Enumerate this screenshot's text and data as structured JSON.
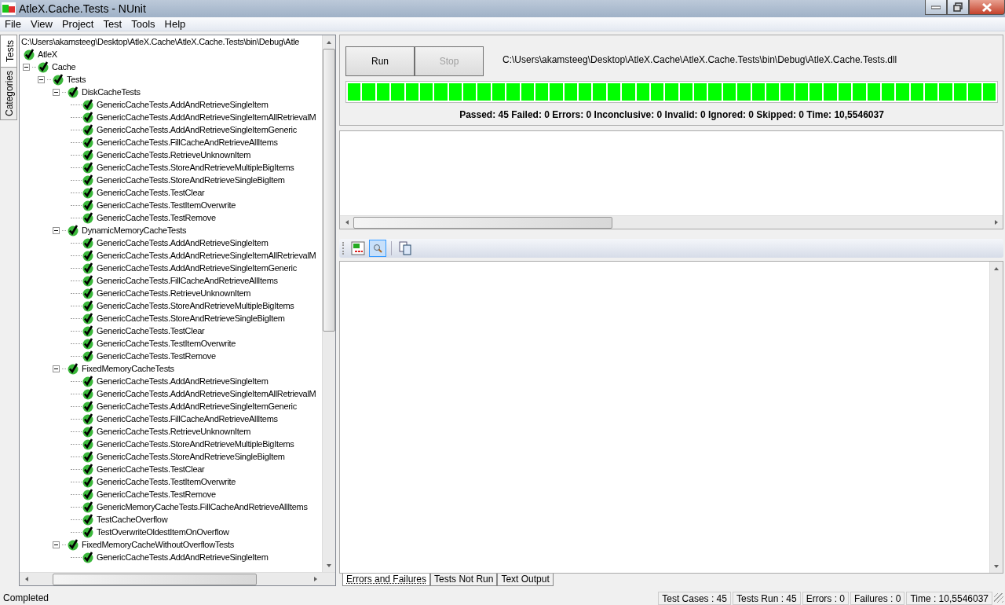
{
  "window": {
    "title": "AtleX.Cache.Tests - NUnit"
  },
  "menu": [
    {
      "label": "File"
    },
    {
      "label": "View"
    },
    {
      "label": "Project"
    },
    {
      "label": "Test"
    },
    {
      "label": "Tools"
    },
    {
      "label": "Help"
    }
  ],
  "side_tabs": [
    {
      "label": "Tests",
      "selected": true
    },
    {
      "label": "Categories",
      "selected": false
    }
  ],
  "tree": {
    "path": "C:\\Users\\akamsteeg\\Desktop\\AtleX.Cache\\AtleX.Cache.Tests\\bin\\Debug\\Atle",
    "nodes": [
      {
        "label": "AtleX",
        "children": [
          {
            "label": "Cache",
            "expanded": true,
            "children": [
              {
                "label": "Tests",
                "expanded": true,
                "children": [
                  {
                    "label": "DiskCacheTests",
                    "expanded": true,
                    "children": [
                      {
                        "label": "GenericCacheTests.AddAndRetrieveSingleItem"
                      },
                      {
                        "label": "GenericCacheTests.AddAndRetrieveSingleItemAllRetrievalM"
                      },
                      {
                        "label": "GenericCacheTests.AddAndRetrieveSingleItemGeneric"
                      },
                      {
                        "label": "GenericCacheTests.FillCacheAndRetrieveAllItems"
                      },
                      {
                        "label": "GenericCacheTests.RetrieveUnknownItem"
                      },
                      {
                        "label": "GenericCacheTests.StoreAndRetrieveMultipleBigItems"
                      },
                      {
                        "label": "GenericCacheTests.StoreAndRetrieveSingleBigItem"
                      },
                      {
                        "label": "GenericCacheTests.TestClear"
                      },
                      {
                        "label": "GenericCacheTests.TestItemOverwrite"
                      },
                      {
                        "label": "GenericCacheTests.TestRemove"
                      }
                    ]
                  },
                  {
                    "label": "DynamicMemoryCacheTests",
                    "expanded": true,
                    "children": [
                      {
                        "label": "GenericCacheTests.AddAndRetrieveSingleItem"
                      },
                      {
                        "label": "GenericCacheTests.AddAndRetrieveSingleItemAllRetrievalM"
                      },
                      {
                        "label": "GenericCacheTests.AddAndRetrieveSingleItemGeneric"
                      },
                      {
                        "label": "GenericCacheTests.FillCacheAndRetrieveAllItems"
                      },
                      {
                        "label": "GenericCacheTests.RetrieveUnknownItem"
                      },
                      {
                        "label": "GenericCacheTests.StoreAndRetrieveMultipleBigItems"
                      },
                      {
                        "label": "GenericCacheTests.StoreAndRetrieveSingleBigItem"
                      },
                      {
                        "label": "GenericCacheTests.TestClear"
                      },
                      {
                        "label": "GenericCacheTests.TestItemOverwrite"
                      },
                      {
                        "label": "GenericCacheTests.TestRemove"
                      }
                    ]
                  },
                  {
                    "label": "FixedMemoryCacheTests",
                    "expanded": true,
                    "children": [
                      {
                        "label": "GenericCacheTests.AddAndRetrieveSingleItem"
                      },
                      {
                        "label": "GenericCacheTests.AddAndRetrieveSingleItemAllRetrievalM"
                      },
                      {
                        "label": "GenericCacheTests.AddAndRetrieveSingleItemGeneric"
                      },
                      {
                        "label": "GenericCacheTests.FillCacheAndRetrieveAllItems"
                      },
                      {
                        "label": "GenericCacheTests.RetrieveUnknownItem"
                      },
                      {
                        "label": "GenericCacheTests.StoreAndRetrieveMultipleBigItems"
                      },
                      {
                        "label": "GenericCacheTests.StoreAndRetrieveSingleBigItem"
                      },
                      {
                        "label": "GenericCacheTests.TestClear"
                      },
                      {
                        "label": "GenericCacheTests.TestItemOverwrite"
                      },
                      {
                        "label": "GenericCacheTests.TestRemove"
                      },
                      {
                        "label": "GenericMemoryCacheTests.FillCacheAndRetrieveAllItems"
                      },
                      {
                        "label": "TestCacheOverflow"
                      },
                      {
                        "label": "TestOverwriteOldestItemOnOverflow"
                      }
                    ]
                  },
                  {
                    "label": "FixedMemoryCacheWithoutOverflowTests",
                    "expanded": true,
                    "children": [
                      {
                        "label": "GenericCacheTests.AddAndRetrieveSingleItem"
                      }
                    ]
                  }
                ]
              }
            ]
          }
        ]
      }
    ]
  },
  "run_panel": {
    "buttons": [
      {
        "label": "Run",
        "disabled": false
      },
      {
        "label": "Stop",
        "disabled": true
      }
    ],
    "assembly": "C:\\Users\\akamsteeg\\Desktop\\AtleX.Cache\\AtleX.Cache.Tests\\bin\\Debug\\AtleX.Cache.Tests.dll",
    "progress": {
      "level": 1
    },
    "summary": "Passed: 45  Failed: 0  Errors: 0  Inconclusive: 0  Invalid: 0  Ignored: 0  Skipped: 0  Time: 10,5546037"
  },
  "toolbar": [
    {
      "kind": "code",
      "selected": false
    },
    {
      "kind": "zoom",
      "selected": true
    },
    {
      "kind": "copy",
      "selected": false
    }
  ],
  "result_tabs": [
    {
      "label": "Errors and Failures",
      "selected": true
    },
    {
      "label": "Tests Not Run",
      "selected": false
    },
    {
      "label": "Text Output",
      "selected": false
    }
  ],
  "status_bar": {
    "text": "Completed",
    "panels": [
      "Test Cases : 45",
      "Tests Run : 45",
      "Errors : 0",
      "Failures : 0",
      "Time : 10,5546037"
    ]
  }
}
